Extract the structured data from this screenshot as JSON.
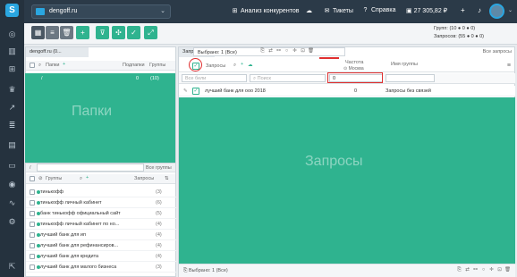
{
  "sidebar": {
    "logo": "S",
    "icons": [
      "chart-icon",
      "sitemap-icon",
      "trophy-icon",
      "line-chart-icon",
      "layers-icon",
      "grid-icon",
      "monitor-icon",
      "target-icon",
      "graph-icon",
      "settings-icon",
      "exit-icon"
    ]
  },
  "topbar": {
    "project_name": "dengoff.ru",
    "competitor_link": "Анализ конкурентов",
    "tickets_link": "Тикеты",
    "help_link": "Справка",
    "balance": "27 305,82 ₽",
    "plus_label": "+"
  },
  "toolbar": {
    "counter": {
      "groups_label": "Групп:",
      "groups_value": "(10 ● 0 ● 0)",
      "queries_label": "Запросов:",
      "queries_value": "(55 ● 0 ● 0)"
    }
  },
  "folders_panel": {
    "title": "dengoff.ru (0...",
    "header_name": "Папки",
    "header_subfolders": "Подпапки",
    "header_groups": "Группы",
    "selected_row": {
      "name": "/",
      "subfolders": "0",
      "groups": "(10)"
    },
    "watermark": "Папки",
    "path": "/",
    "all_groups": "Все группы"
  },
  "groups_panel": {
    "header_name": "Группы",
    "header_queries": "Запросы",
    "rows": [
      {
        "name": "тинькофф",
        "count": "(3)"
      },
      {
        "name": "тинькофф личный кабинет",
        "count": "(6)"
      },
      {
        "name": "банк тинькофф официальный сайт",
        "count": "(5)"
      },
      {
        "name": "тинькофф личный кабинет по но...",
        "count": "(4)"
      },
      {
        "name": "лучший банк для ип",
        "count": "(4)"
      },
      {
        "name": "лучший банк для рефинансиров...",
        "count": "(4)"
      },
      {
        "name": "лучший банк для кредита",
        "count": "(4)"
      },
      {
        "name": "лучший банк для малого бизнеса",
        "count": "(3)"
      }
    ]
  },
  "queries_panel": {
    "title": "Запросы б",
    "tooltip_selected": "Выбрано: 1 (Все)",
    "header_queries": "Запросы",
    "header_freq": "Частота",
    "header_freq_sub": "Москва",
    "header_group": "Имя группы",
    "all_queries": "Все запросы",
    "search_placeholder": "Поиск",
    "filter_placeholder": "Все бели",
    "freq_filter_value": "0",
    "row": {
      "query": "лучший банк для ооо 2018",
      "freq": "0",
      "group": "Запросы без связей"
    },
    "watermark": "Запросы",
    "footer_selected": "Выбрано: 1 (Все)"
  },
  "colors": {
    "accent": "#2fb38f",
    "brand": "#2aa6e0",
    "highlight": "#e03030"
  }
}
